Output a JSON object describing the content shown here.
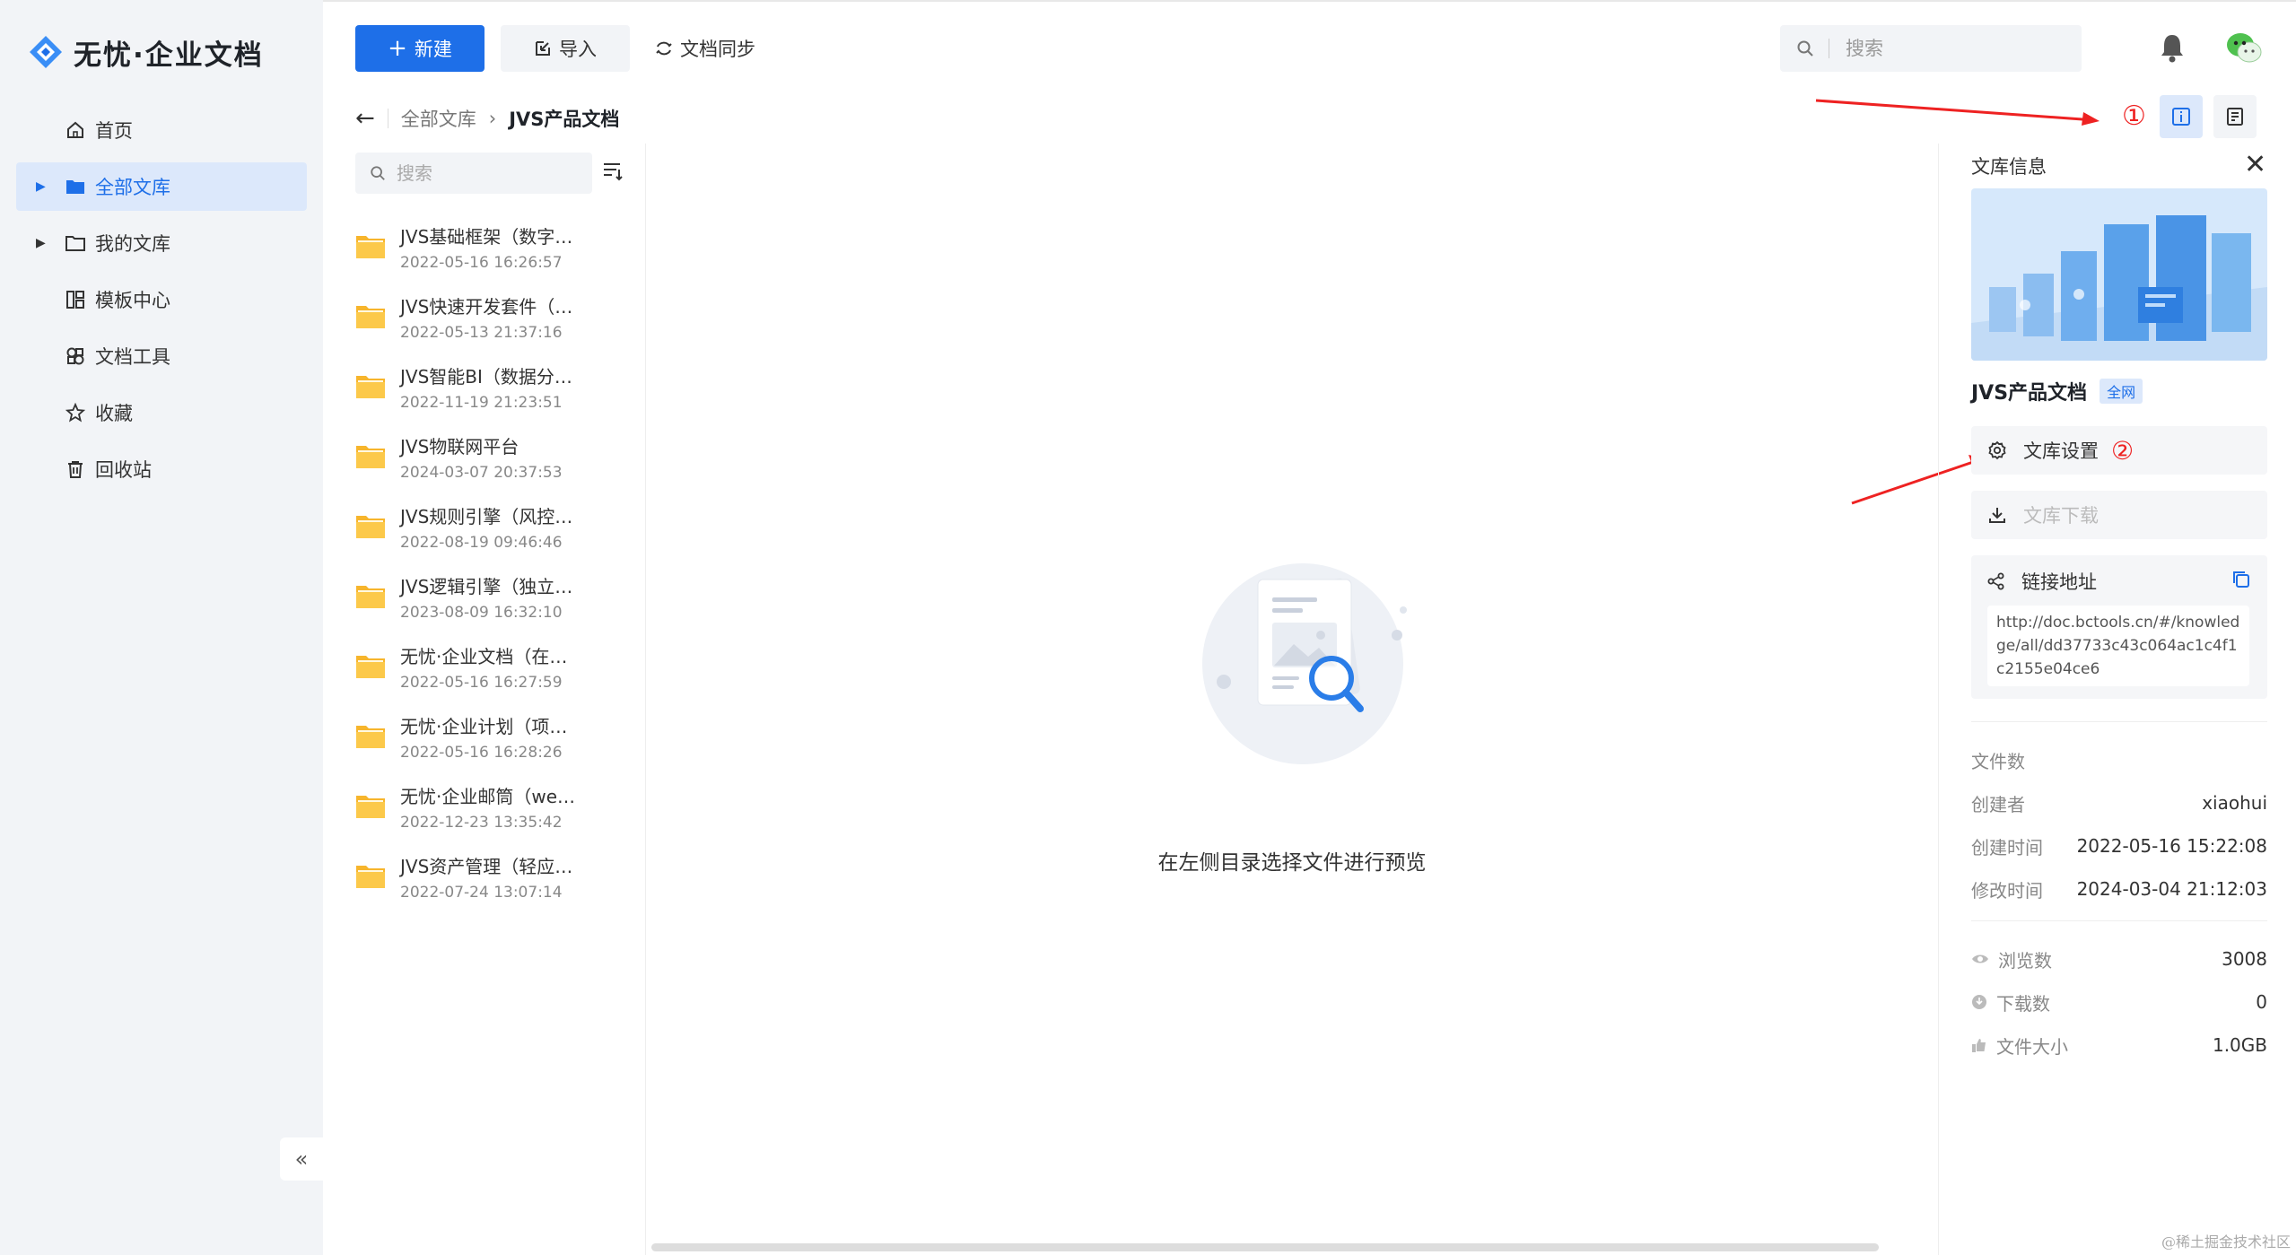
{
  "app": {
    "logo_text": "无忧·企业文档"
  },
  "sidebar": {
    "items": [
      {
        "label": "首页",
        "icon": "home-icon"
      },
      {
        "label": "全部文库",
        "icon": "folder-filled-icon",
        "active": true,
        "expandable": true
      },
      {
        "label": "我的文库",
        "icon": "folder-icon",
        "expandable": true
      },
      {
        "label": "模板中心",
        "icon": "template-icon"
      },
      {
        "label": "文档工具",
        "icon": "tools-icon"
      },
      {
        "label": "收藏",
        "icon": "star-icon"
      },
      {
        "label": "回收站",
        "icon": "trash-icon"
      }
    ],
    "collapse_label": "«"
  },
  "toolbar": {
    "new_label": "新建",
    "import_label": "导入",
    "sync_label": "文档同步",
    "search_placeholder": "搜索"
  },
  "breadcrumb": {
    "root": "全部文库",
    "current": "JVS产品文档"
  },
  "annotations": {
    "one": "①",
    "two": "②"
  },
  "file_panel": {
    "search_placeholder": "搜索",
    "files": [
      {
        "name": "JVS基础框架（数字…",
        "date": "2022-05-16 16:26:57"
      },
      {
        "name": "JVS快速开发套件（…",
        "date": "2022-05-13 21:37:16"
      },
      {
        "name": "JVS智能BI（数据分…",
        "date": "2022-11-19 21:23:51"
      },
      {
        "name": "JVS物联网平台",
        "date": "2024-03-07 20:37:53"
      },
      {
        "name": "JVS规则引擎（风控…",
        "date": "2022-08-19 09:46:46"
      },
      {
        "name": "JVS逻辑引擎（独立…",
        "date": "2023-08-09 16:32:10"
      },
      {
        "name": "无忧·企业文档（在…",
        "date": "2022-05-16 16:27:59"
      },
      {
        "name": "无忧·企业计划（项…",
        "date": "2022-05-16 16:28:26"
      },
      {
        "name": "无忧·企业邮筒（we…",
        "date": "2022-12-23 13:35:42"
      },
      {
        "name": "JVS资产管理（轻应…",
        "date": "2022-07-24 13:07:14"
      }
    ]
  },
  "preview": {
    "empty_text": "在左侧目录选择文件进行预览"
  },
  "info_panel": {
    "title": "文库信息",
    "library_name": "JVS产品文档",
    "scope_badge": "全网",
    "settings_label": "文库设置",
    "download_label": "文库下载",
    "link_label": "链接地址",
    "link_url": "http://doc.bctools.cn/#/knowledge/all/dd37733c43c064ac1c4f1c2155e04ce6",
    "doc_count_label": "文件数",
    "creator_label": "创建者",
    "creator": "xiaohui",
    "created_label": "创建时间",
    "created": "2022-05-16 15:22:08",
    "modified_label": "修改时间",
    "modified": "2024-03-04 21:12:03",
    "views_label": "浏览数",
    "views": "3008",
    "downloads_label": "下载数",
    "downloads": "0",
    "size_label": "文件大小",
    "size": "1.0GB"
  },
  "footer": {
    "watermark": "@稀土掘金技术社区"
  },
  "colors": {
    "accent": "#1e6fe8",
    "active_bg": "#dce8fb",
    "annotation_red": "#e22",
    "folder": "#f7b52c"
  }
}
